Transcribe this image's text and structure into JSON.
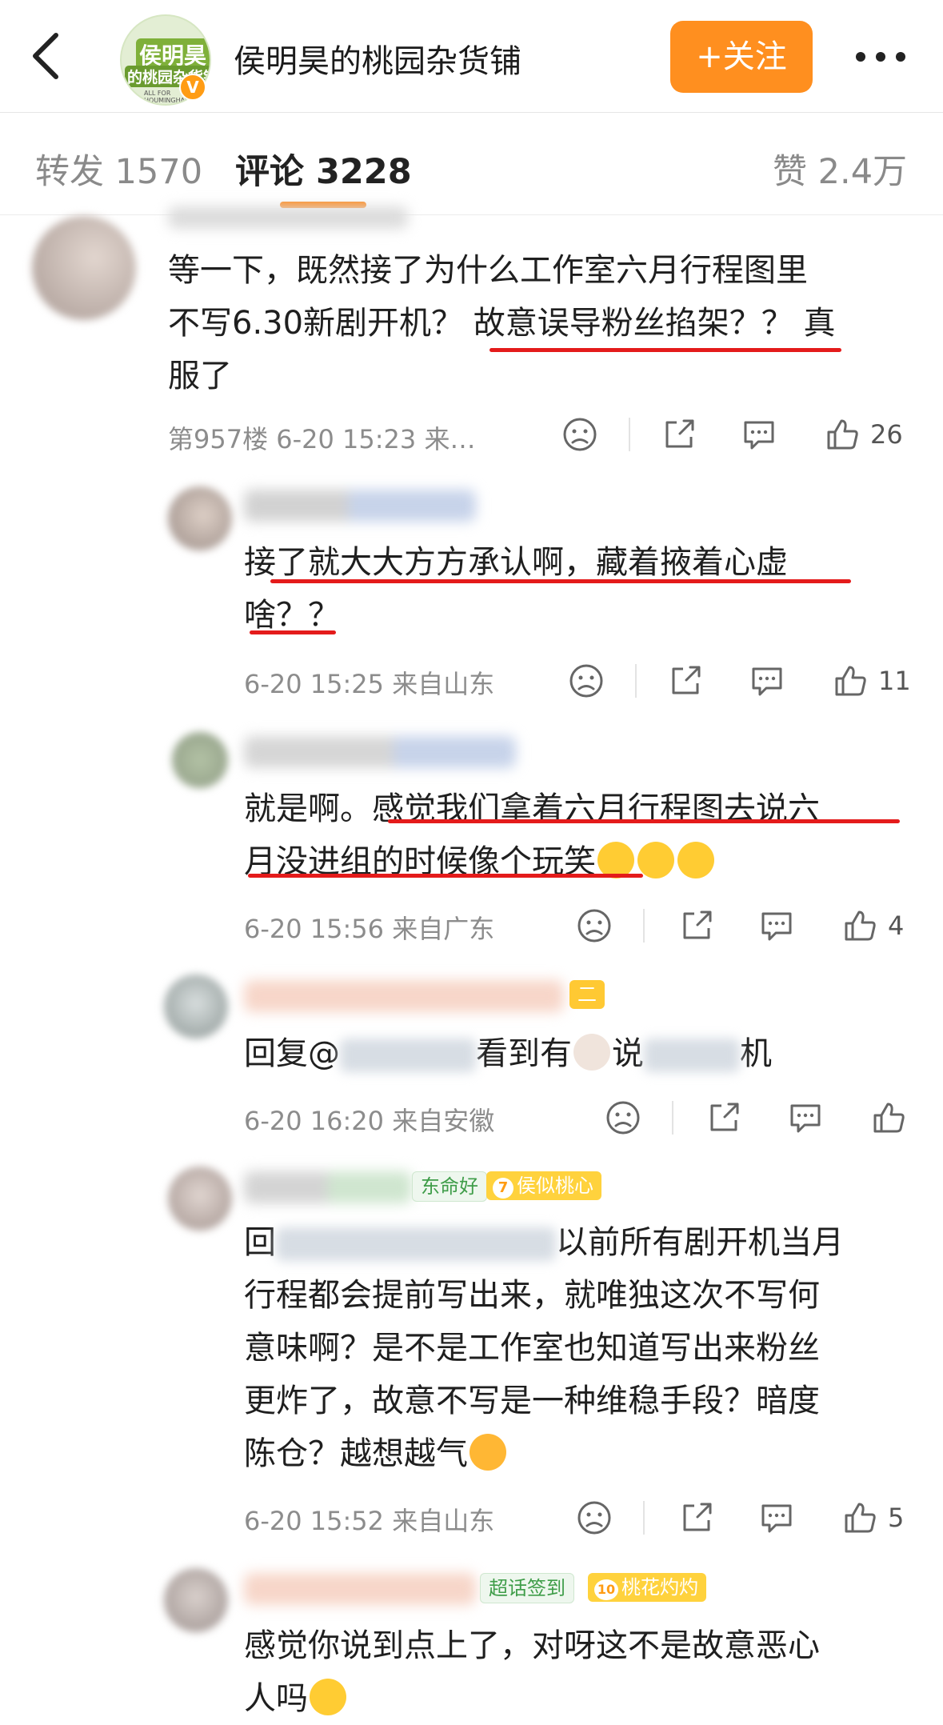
{
  "header": {
    "title": "侯明昊的桃园杂货铺",
    "follow_label": "+关注",
    "logo_text_line1": "侯明昊",
    "logo_text_line2": "的桃园杂货铺",
    "logo_text_line3": "ALL FOR HOUMINGHAO",
    "verified_mark": "V"
  },
  "tabs": {
    "repost": "转发 1570",
    "comments": "评论 3228",
    "likes": "赞 2.4万"
  },
  "comments": [
    {
      "text_plain1": "等一下，既然接了为什么工作室六月行程图里",
      "text_plain2": "不写6.30新剧开机？",
      "text_highlight": "故意误导粉丝掐架？？",
      "text_plain3": "真",
      "text_plain4": "服了",
      "meta": "第957楼 6-20 15:23 来…",
      "likes": "26"
    },
    {
      "text_line1": "接了就大大方方承认啊，藏着掖着心虚",
      "text_line2": "啥？？",
      "meta": "6-20 15:25 来自山东",
      "likes": "11"
    },
    {
      "text_plain": "就是啊。",
      "text_line1_hl": "感觉我们拿着六月行程图去说六",
      "text_line2_hl": "月没进组的时候像个玩笑",
      "meta": "6-20 15:56 来自广东",
      "likes": "4"
    },
    {
      "text_prefix": "回复@",
      "text_mid": "看到有",
      "text_say": "说",
      "text_end": "机",
      "badge": "二",
      "meta": "6-20 16:20 来自安徽",
      "likes": ""
    },
    {
      "badge1": "东命好",
      "badge2_level": "7",
      "badge2": "侯似桃心",
      "text_prefix": "回",
      "text_line1_end": "以前所有剧开机当月",
      "text_line2": "行程都会提前写出来，就唯独这次不写何",
      "text_line3": "意味啊？是不是工作室也知道写出来粉丝",
      "text_line4": "更炸了，故意不写是一种维稳手段？暗度",
      "text_line5": "陈仓？越想越气",
      "meta": "6-20 15:52 来自山东",
      "likes": "5"
    },
    {
      "badge1": "超话签到",
      "badge2_level": "10",
      "badge2": "桃花灼灼",
      "text_line1": "感觉你说到点上了，对呀这不是故意恶心",
      "text_line2": "人吗"
    }
  ],
  "colors": {
    "accent": "#ff8f1f",
    "underline": "#e41b1b",
    "meta_text": "#8c8c8c"
  },
  "icons": {
    "back": "chevron-left-icon",
    "more": "more-dots-icon",
    "dislike": "frown-face-icon",
    "share": "share-icon",
    "comment": "comment-bubble-icon",
    "like": "thumbs-up-icon"
  }
}
